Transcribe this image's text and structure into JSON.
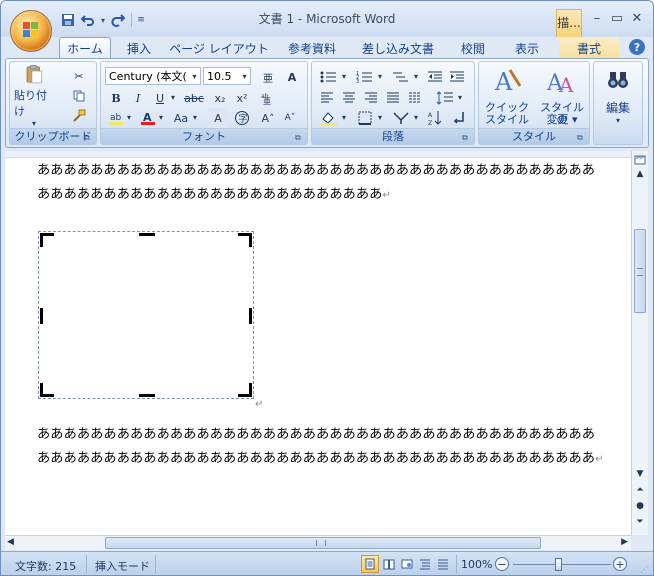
{
  "window": {
    "title": "文書 1 - Microsoft Word",
    "context_tab_short": "描..."
  },
  "quick_access": {
    "save_icon": "save-icon",
    "undo_icon": "undo-icon",
    "redo_icon": "redo-icon",
    "customize_icon": "customize-qat-icon"
  },
  "tabs": [
    {
      "label": "ホーム",
      "active": true
    },
    {
      "label": "挿入"
    },
    {
      "label": "ページ レイアウト"
    },
    {
      "label": "参考資料"
    },
    {
      "label": "差し込み文書"
    },
    {
      "label": "校閲"
    },
    {
      "label": "表示"
    },
    {
      "label": "書式",
      "contextual": true
    }
  ],
  "ribbon": {
    "clipboard": {
      "label": "クリップボード",
      "paste_label": "貼り付け"
    },
    "font": {
      "label": "フォント",
      "font_name": "Century (本文(",
      "font_size": "10.5"
    },
    "paragraph": {
      "label": "段落"
    },
    "styles": {
      "label": "スタイル",
      "quick_style_line1": "クイック",
      "quick_style_line2": "スタイル",
      "change_style_line1": "スタイルの",
      "change_style_line2": "変更"
    },
    "editing": {
      "label": "編集"
    }
  },
  "document": {
    "paragraph1": "ああああああああああああああああああああああああああああああああああああああああああああああああああああああああああああああああああああ",
    "paragraph2": "ああああああああああああああああああああああああああああああああああああああああああああああああああああああああああああああああああああああああああああああああああああ",
    "paragraph_mark": "↵"
  },
  "status": {
    "word_count": "文字数: 215",
    "mode": "挿入モード",
    "zoom": "100%"
  },
  "colors": {
    "font_color_underline": "#e81e1e",
    "highlight": "#f7e75a"
  }
}
